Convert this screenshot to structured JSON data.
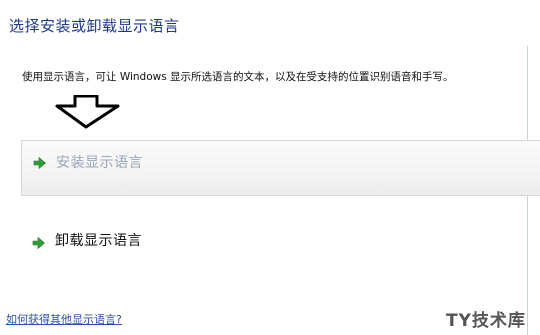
{
  "window": {
    "title": "选择安装或卸载显示语言"
  },
  "description": "使用显示语言，可让 Windows 显示所选语言的文本，以及在受支持的位置识别语音和手写。",
  "options": {
    "install_label": "安装显示语言",
    "uninstall_label": "卸载显示语言"
  },
  "help_link": "如何获得其他显示语言?",
  "watermark": "TY技术库",
  "icons": {
    "annotation_arrow": "down-arrow-icon",
    "option_arrow": "green-right-arrow-icon"
  },
  "colors": {
    "title": "#1e3a8a",
    "option_arrow": "#2e9c3a",
    "link": "#2a4fb0",
    "disabled_text": "#9aa7b8"
  }
}
